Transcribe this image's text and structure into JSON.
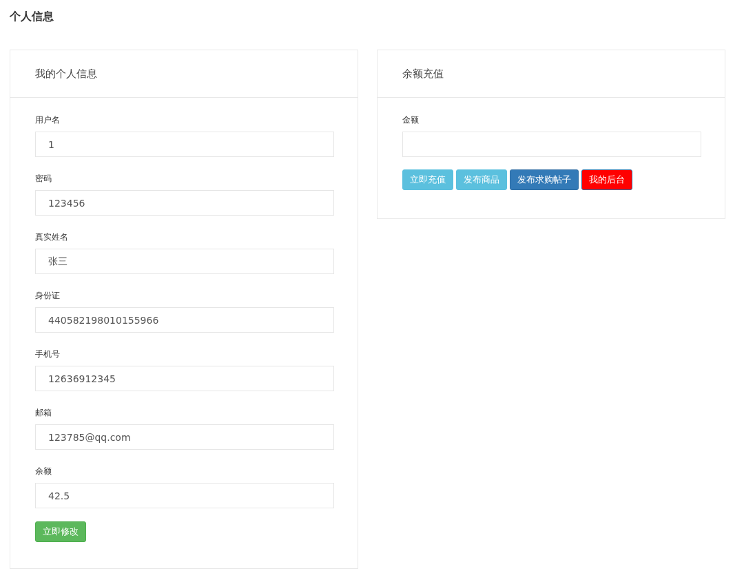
{
  "page_title": "个人信息",
  "profile": {
    "title": "我的个人信息",
    "fields": [
      {
        "label": "用户名",
        "value": "1"
      },
      {
        "label": "密码",
        "value": "123456"
      },
      {
        "label": "真实姓名",
        "value": "张三"
      },
      {
        "label": "身份证",
        "value": "440582198010155966"
      },
      {
        "label": "手机号",
        "value": "12636912345"
      },
      {
        "label": "邮箱",
        "value": "123785@qq.com"
      },
      {
        "label": "余额",
        "value": "42.5"
      }
    ],
    "submit": "立即修改"
  },
  "recharge": {
    "title": "余额充值",
    "amount_label": "金额",
    "buttons": [
      {
        "label": "立即充值",
        "kind": "info"
      },
      {
        "label": "发布商品",
        "kind": "info"
      },
      {
        "label": "发布求购帖子",
        "kind": "primary"
      },
      {
        "label": "我的后台",
        "kind": "danger"
      }
    ]
  }
}
